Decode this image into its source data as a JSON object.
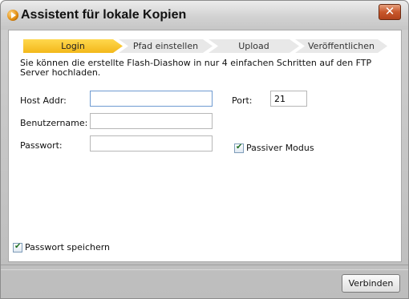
{
  "window": {
    "title": "Assistent für lokale Kopien",
    "close_symbol": "✕",
    "app_icon": "play-icon"
  },
  "steps": [
    {
      "label": "Login",
      "active": true
    },
    {
      "label": "Pfad einstellen",
      "active": false
    },
    {
      "label": "Upload",
      "active": false
    },
    {
      "label": "Veröffentlichen",
      "active": false
    }
  ],
  "description": "Sie können die erstellte Flash-Diashow in nur 4 einfachen Schritten auf den FTP Server hochladen.",
  "form": {
    "host_label": "Host Addr:",
    "host_value": "",
    "port_label": "Port:",
    "port_value": "21",
    "user_label": "Benutzername:",
    "user_value": "",
    "password_label": "Passwort:",
    "password_value": "",
    "passive_label": "Passiver Modus",
    "passive_checked": true,
    "save_password_label": "Passwort speichern",
    "save_password_checked": true
  },
  "footer": {
    "connect_label": "Verbinden"
  },
  "colors": {
    "active_step": "#f3b81a",
    "close_button": "#c8572b"
  }
}
